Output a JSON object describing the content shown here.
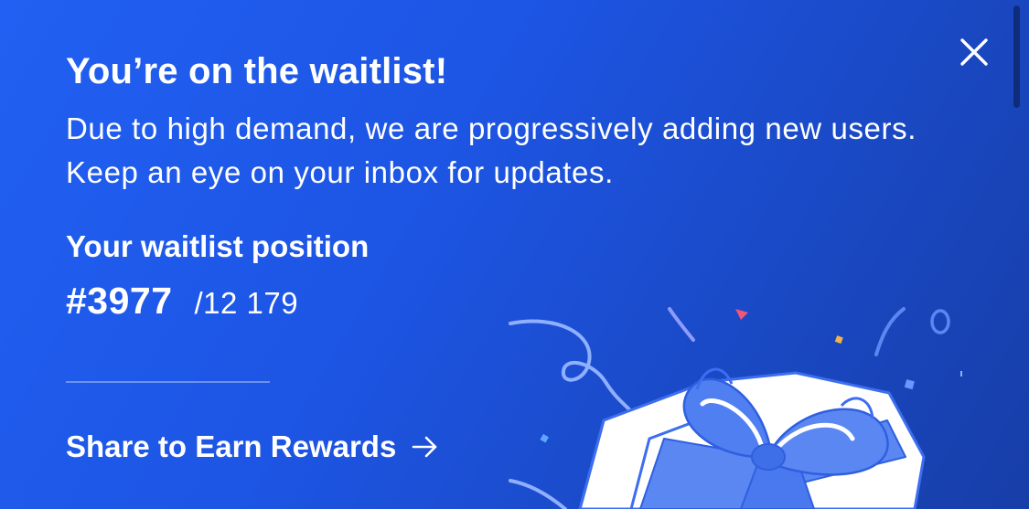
{
  "waitlist": {
    "title": "You’re on the waitlist!",
    "description": "Due to high demand, we are progressively adding new users. Keep an eye on your inbox for updates.",
    "position_label": "Your waitlist position",
    "position_value": "#3977",
    "position_total": "/12 179",
    "share_label": "Share to Earn Rewards"
  },
  "icons": {
    "close": "close-icon",
    "arrow": "arrow-right-icon",
    "illustration": "gift-box-illustration"
  },
  "colors": {
    "background_start": "#2160f2",
    "background_end": "#173ea8",
    "text": "#ffffff",
    "gift_ribbon": "#5b87f2",
    "confetti_pink": "#f2557a",
    "confetti_yellow": "#f4b24a"
  }
}
